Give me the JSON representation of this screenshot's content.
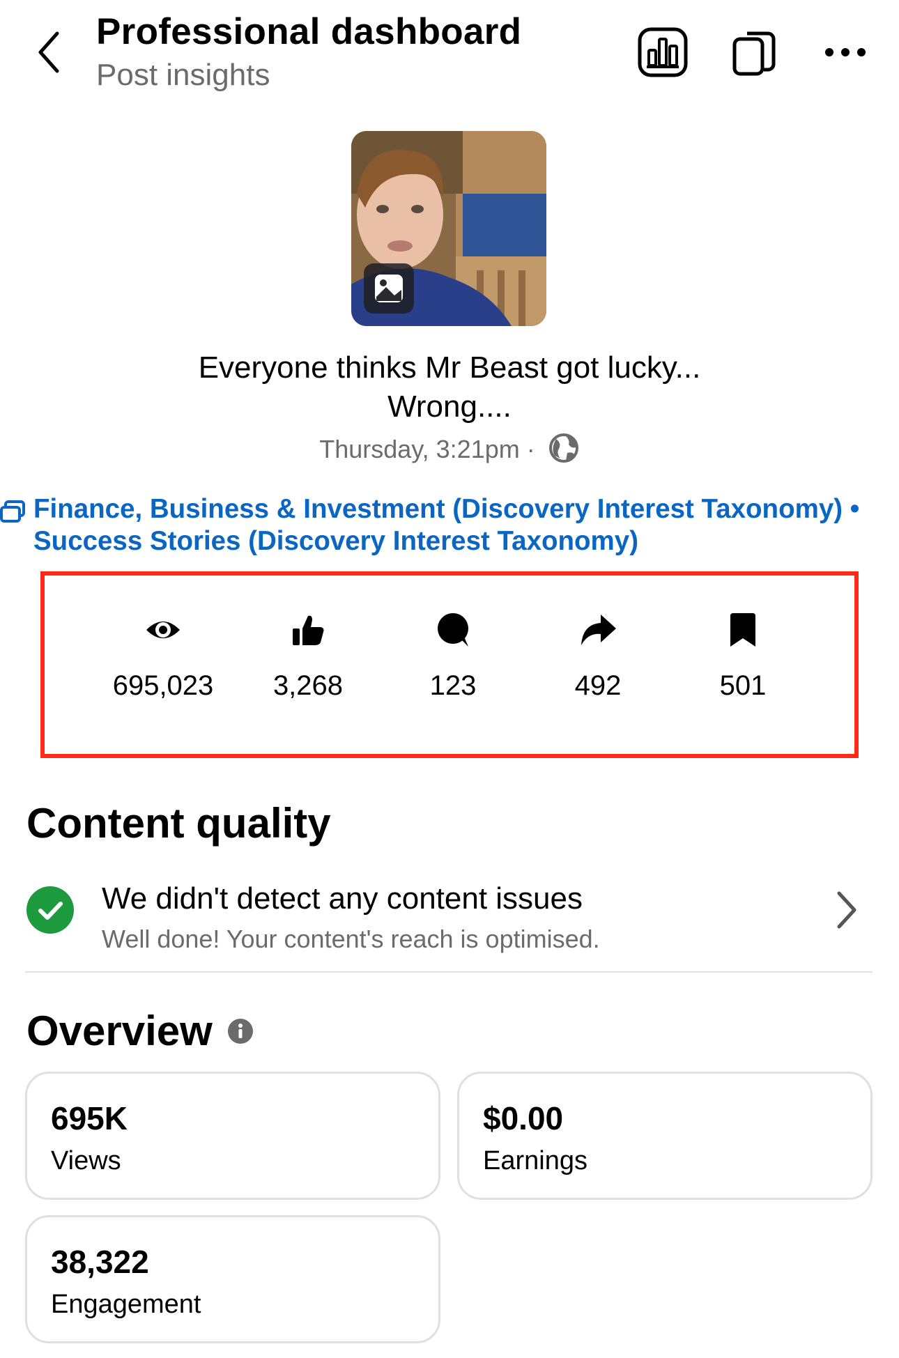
{
  "header": {
    "title": "Professional dashboard",
    "subtitle": "Post insights",
    "icons": [
      "back-chevron-icon",
      "insights-chart-icon",
      "copy-icon",
      "more-icon"
    ]
  },
  "post": {
    "title_line1": "Everyone thinks Mr Beast got lucky...",
    "title_line2": "Wrong....",
    "timestamp": "Thursday, 3:21pm ·",
    "visibility_icon": "globe-icon",
    "media_badge_icon": "image-icon"
  },
  "tags": {
    "line1": "Finance, Business & Investment (Discovery Interest Taxonomy)  •",
    "line2": "Success Stories (Discovery Interest Taxonomy)"
  },
  "stats": [
    {
      "icon": "eye-icon",
      "value": "695,023"
    },
    {
      "icon": "thumbs-up-icon",
      "value": "3,268"
    },
    {
      "icon": "comment-icon",
      "value": "123"
    },
    {
      "icon": "share-icon",
      "value": "492"
    },
    {
      "icon": "bookmark-icon",
      "value": "501"
    }
  ],
  "content_quality": {
    "heading": "Content quality",
    "title": "We didn't detect any content issues",
    "subtitle": "Well done! Your content's reach is optimised."
  },
  "overview": {
    "heading": "Overview",
    "cards": [
      {
        "value": "695K",
        "label": "Views"
      },
      {
        "value": "$0.00",
        "label": "Earnings"
      },
      {
        "value": "38,322",
        "label": "Engagement"
      }
    ]
  },
  "colors": {
    "link_blue": "#0a66c2",
    "highlight_red": "#ff2a17",
    "success_green": "#1e9a3e",
    "muted_text": "#6b6b6b"
  }
}
